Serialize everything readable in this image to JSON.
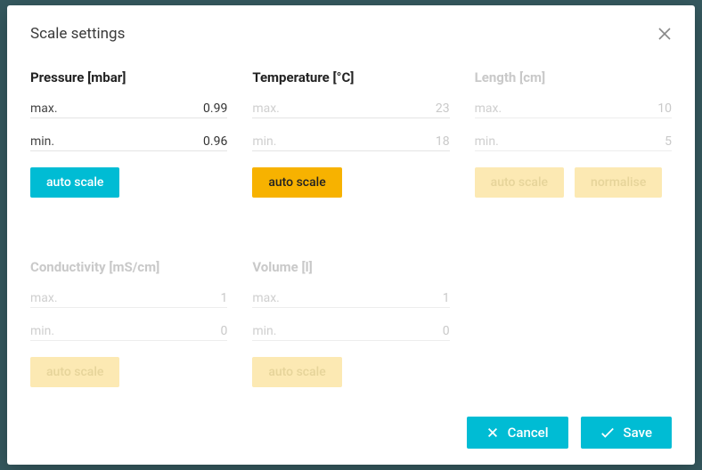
{
  "modal": {
    "title": "Scale settings"
  },
  "labels": {
    "max": "max.",
    "min": "min.",
    "auto_scale": "auto scale",
    "normalise": "normalise"
  },
  "panels": {
    "pressure": {
      "title": "Pressure [mbar]",
      "max": "0.99",
      "min": "0.96",
      "enabled": true,
      "active": true
    },
    "temperature": {
      "title": "Temperature [°C]",
      "max": "23",
      "min": "18",
      "enabled": true,
      "active": false
    },
    "length": {
      "title": "Length [cm]",
      "max": "10",
      "min": "5",
      "enabled": false,
      "active": false,
      "has_normalise": true
    },
    "conductivity": {
      "title": "Conductivity [mS/cm]",
      "max": "1",
      "min": "0",
      "enabled": false,
      "active": false
    },
    "volume": {
      "title": "Volume [l]",
      "max": "1",
      "min": "0",
      "enabled": false,
      "active": false
    }
  },
  "footer": {
    "cancel": "Cancel",
    "save": "Save"
  }
}
